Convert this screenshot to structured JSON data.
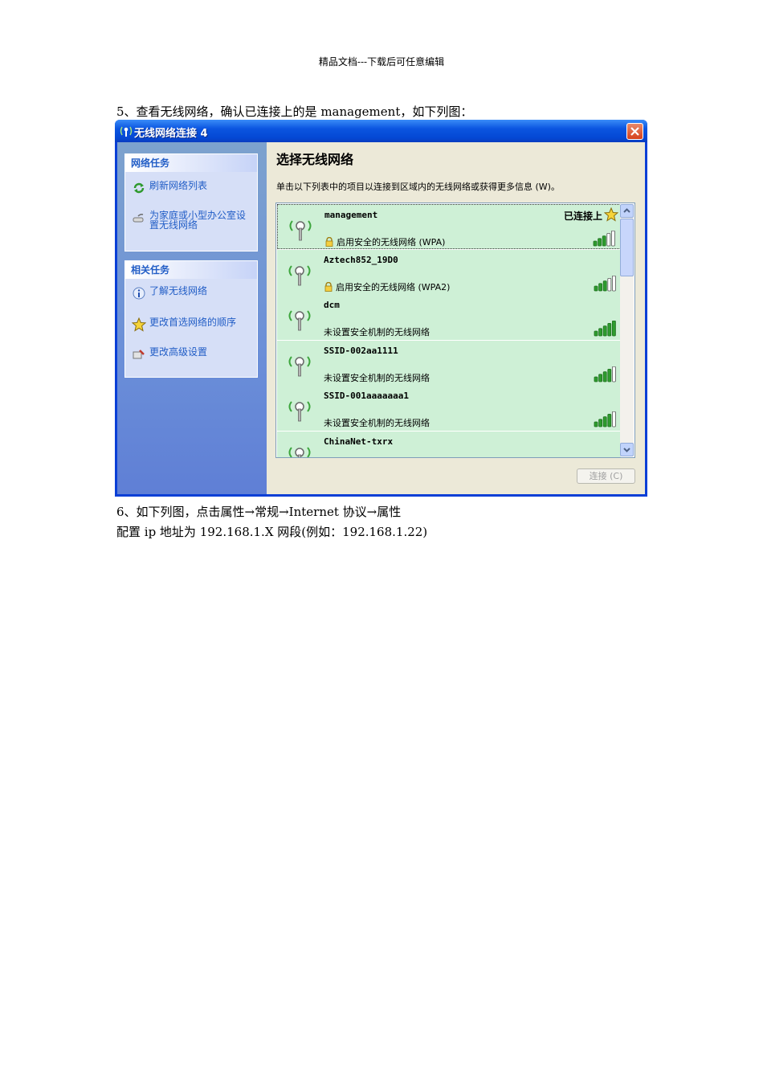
{
  "header": "精品文档---下载后可任意编辑",
  "para5": "5、查看无线网络，确认已连接上的是 management，如下列图：",
  "para6": "6、如下列图，点击属性→常规→Internet 协议→属性",
  "para7": "配置 ip 地址为 192.168.1.X 网段(例如：192.168.1.22)",
  "window": {
    "title": "无线网络连接 4",
    "sidebar": {
      "network_tasks": {
        "heading": "网络任务",
        "items": [
          {
            "label": "刷新网络列表",
            "icon": "refresh-icon"
          },
          {
            "label": "为家庭或小型办公室设置无线网络",
            "icon": "wizard-icon"
          }
        ]
      },
      "related_tasks": {
        "heading": "相关任务",
        "items": [
          {
            "label": "了解无线网络",
            "icon": "info-icon"
          },
          {
            "label": "更改首选网络的顺序",
            "icon": "star-icon"
          },
          {
            "label": "更改高级设置",
            "icon": "settings-icon"
          }
        ]
      }
    },
    "main": {
      "title": "选择无线网络",
      "description": "单击以下列表中的项目以连接到区域内的无线网络或获得更多信息 (W)。",
      "networks": [
        {
          "ssid": "management",
          "security": "启用安全的无线网络 (WPA)",
          "status": "已连接上",
          "secured": true,
          "signal": 3
        },
        {
          "ssid": "Aztech852_19D0",
          "security": "启用安全的无线网络 (WPA2)",
          "status": "",
          "secured": true,
          "signal": 3
        },
        {
          "ssid": "dcm",
          "security": "未设置安全机制的无线网络",
          "status": "",
          "secured": false,
          "signal": 5
        },
        {
          "ssid": "SSID-002aa1111",
          "security": "未设置安全机制的无线网络",
          "status": "",
          "secured": false,
          "signal": 4
        },
        {
          "ssid": "SSID-001aaaaaaa1",
          "security": "未设置安全机制的无线网络",
          "status": "",
          "secured": false,
          "signal": 4
        },
        {
          "ssid": "ChinaNet-txrx",
          "security": "",
          "status": "",
          "secured": false,
          "signal": 0
        }
      ],
      "connect_label": "连接 (C)"
    },
    "colors": {
      "connected_bg": "#cef0d6",
      "signal_green": "#2e9c2e",
      "link_blue": "#215dc6"
    }
  }
}
